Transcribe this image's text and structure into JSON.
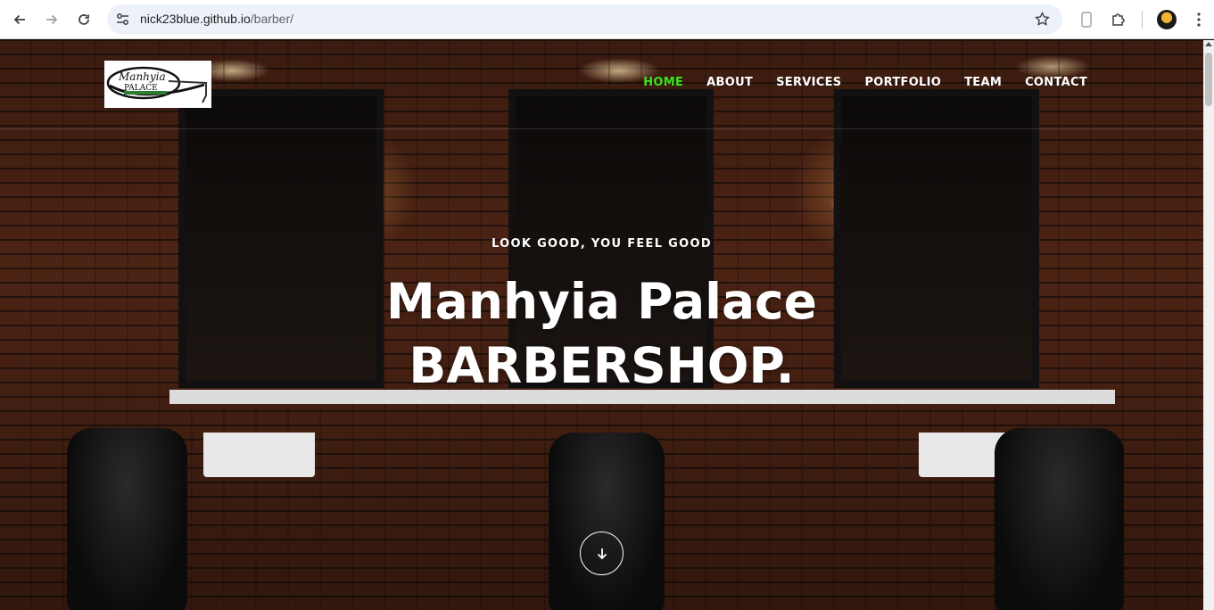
{
  "browser": {
    "url_host": "nick23blue.github.io",
    "url_path": "/barber/"
  },
  "site": {
    "logo_text": "Manhyia PALACE",
    "nav": [
      {
        "label": "HOME",
        "active": true
      },
      {
        "label": "ABOUT",
        "active": false
      },
      {
        "label": "SERVICES",
        "active": false
      },
      {
        "label": "PORTFOLIO",
        "active": false
      },
      {
        "label": "TEAM",
        "active": false
      },
      {
        "label": "CONTACT",
        "active": false
      }
    ],
    "nav_active_color": "#39e41c"
  },
  "hero": {
    "tagline": "LOOK GOOD, YOU FEEL GOOD",
    "title_line1": "Manhyia Palace",
    "title_line2": "BARBERSHOP."
  },
  "icons": {
    "back": "arrow-left-icon",
    "forward": "arrow-right-icon",
    "reload": "reload-icon",
    "site_info": "tune-icon",
    "bookmark": "star-icon",
    "scroll_down": "arrow-down-icon"
  }
}
